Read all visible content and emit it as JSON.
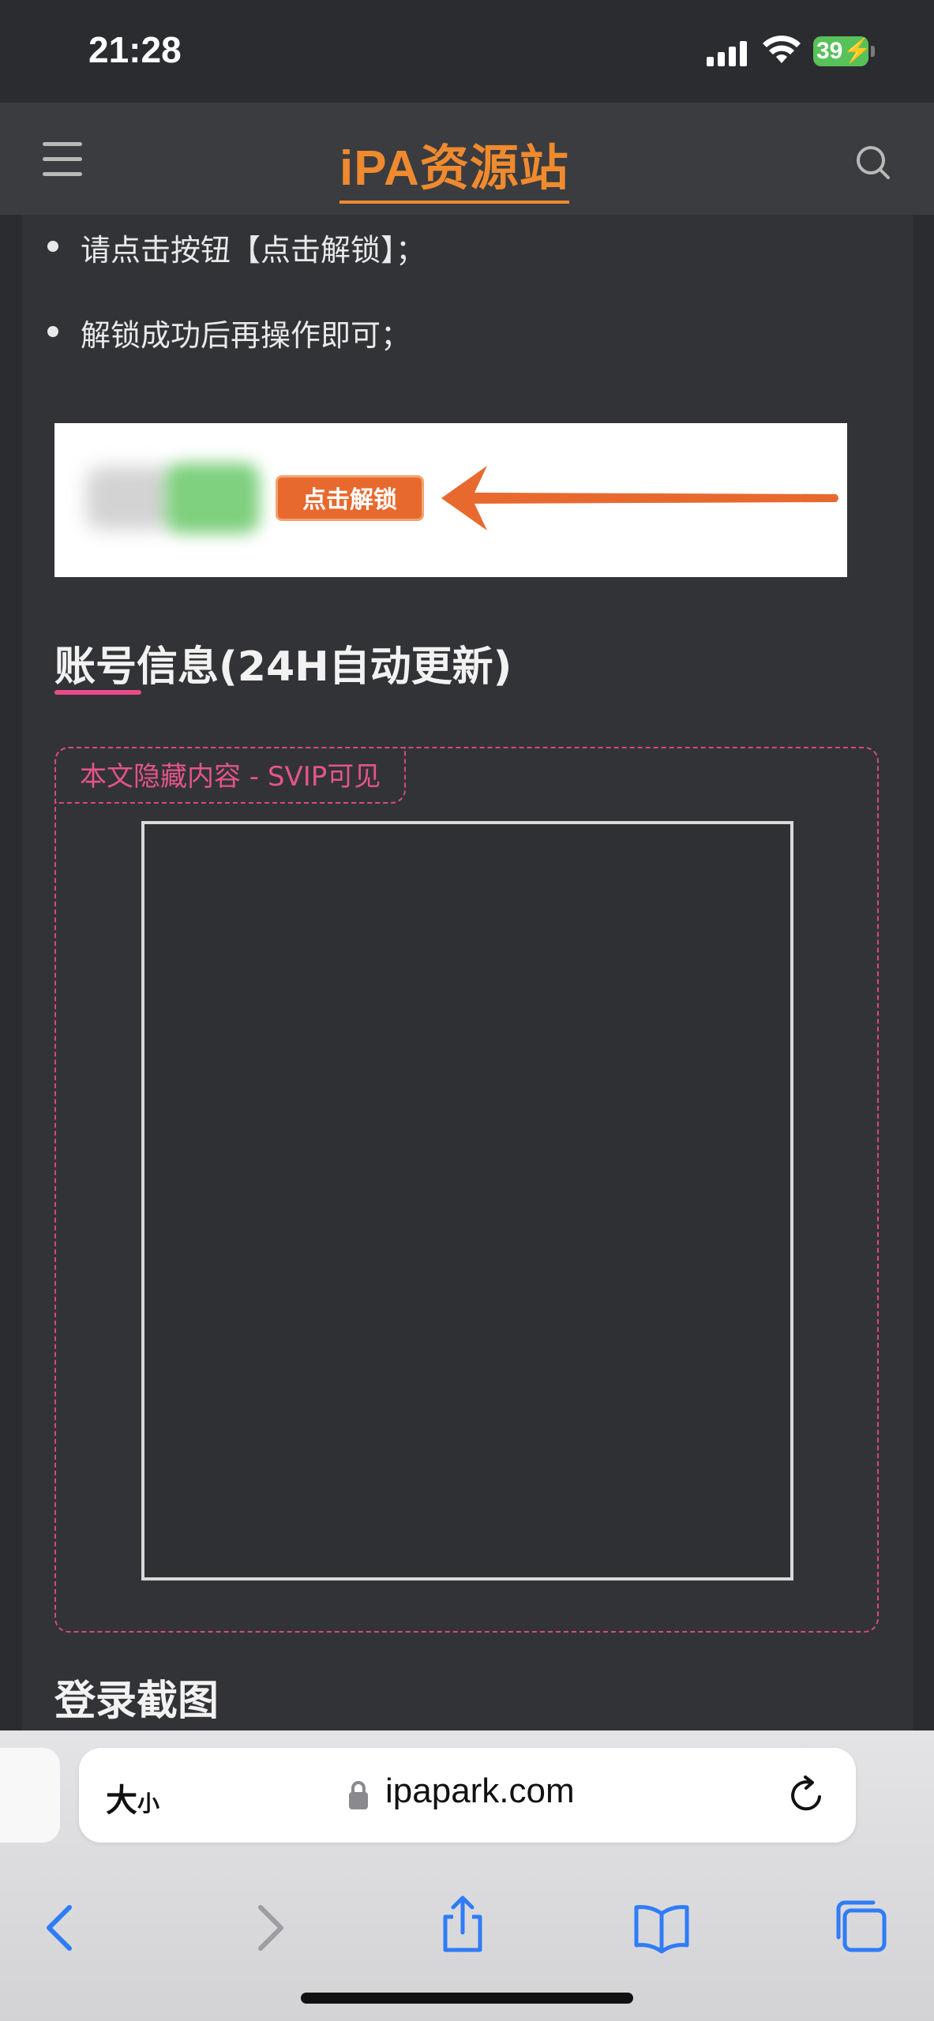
{
  "status_bar": {
    "time": "21:28",
    "battery_level": "39"
  },
  "header": {
    "logo": "iPA资源站",
    "menu_icon": "hamburger-menu-icon",
    "search_icon": "search-icon"
  },
  "content": {
    "bullets": [
      "请点击按钮【点击解锁】；",
      "解锁成功后再操作即可；"
    ],
    "unlock_banner": {
      "button_label": "点击解锁"
    },
    "account_section_title": "账号信息(24H自动更新)",
    "hidden_notice": "本文隐藏内容 - SVIP可见",
    "screenshot_section_title": "登录截图"
  },
  "browser": {
    "text_size_big": "大",
    "text_size_small": "小",
    "url": "ipapark.com",
    "toolbar_icons": [
      "back-icon",
      "forward-icon",
      "share-icon",
      "bookmarks-icon",
      "tabs-icon"
    ]
  },
  "colors": {
    "accent_orange": "#ef8a2f",
    "accent_pink": "#e84b8a",
    "background": "#323336"
  }
}
